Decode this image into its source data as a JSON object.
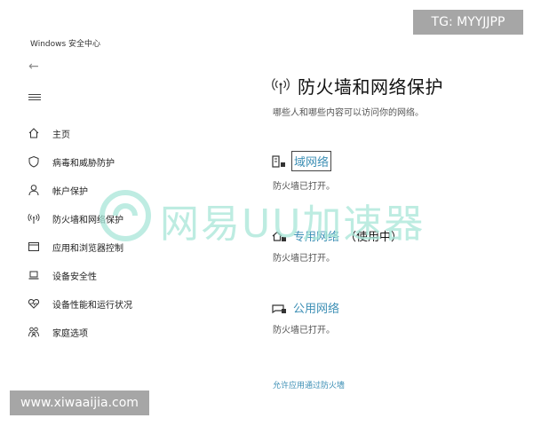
{
  "window": {
    "title": "Windows 安全中心"
  },
  "nav": {
    "items": [
      {
        "label": "主页",
        "icon": "home-icon"
      },
      {
        "label": "病毒和威胁防护",
        "icon": "shield-icon"
      },
      {
        "label": "帐户保护",
        "icon": "person-icon"
      },
      {
        "label": "防火墙和网络保护",
        "icon": "antenna-icon"
      },
      {
        "label": "应用和浏览器控制",
        "icon": "window-icon"
      },
      {
        "label": "设备安全性",
        "icon": "laptop-icon"
      },
      {
        "label": "设备性能和运行状况",
        "icon": "heart-icon"
      },
      {
        "label": "家庭选项",
        "icon": "family-icon"
      }
    ]
  },
  "main": {
    "title": "防火墙和网络保护",
    "subtitle": "哪些人和哪些内容可以访问你的网络。",
    "networks": [
      {
        "name": "域网络",
        "state": "",
        "status": "防火墙已打开。",
        "icon": "domain-network-icon"
      },
      {
        "name": "专用网络",
        "state": "（使用中）",
        "status": "防火墙已打开。",
        "icon": "private-network-icon"
      },
      {
        "name": "公用网络",
        "state": "",
        "status": "防火墙已打开。",
        "icon": "public-network-icon"
      }
    ],
    "allow_link": "允许应用通过防火墙"
  },
  "watermark": {
    "text": "网易UU加速器"
  },
  "tags": {
    "tg": "TG: MYYJJPP",
    "site": "www.xiwaaijia.com"
  },
  "colors": {
    "link": "#3d8fb5",
    "watermark": "#a8e6d8",
    "tag_bg": "#a6a6a6"
  }
}
